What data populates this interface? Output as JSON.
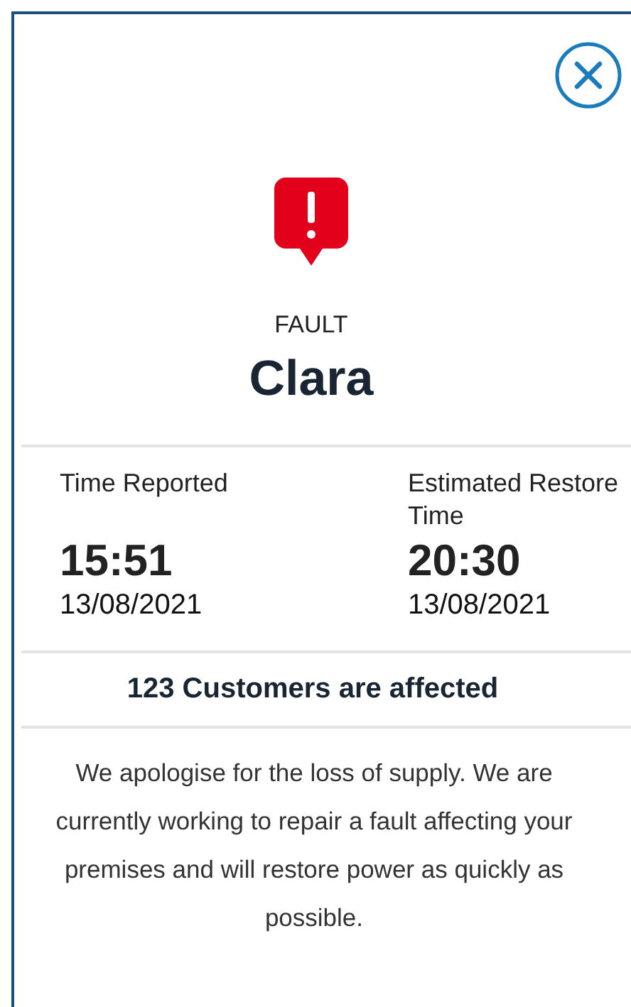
{
  "category": "FAULT",
  "name": "Clara",
  "times": [
    {
      "label": "Time Reported",
      "time": "15:51",
      "date": "13/08/2021"
    },
    {
      "label": "Estimated Restore Time",
      "time": "20:30",
      "date": "13/08/2021"
    }
  ],
  "customers": "123 Customers are affected",
  "message": "We apologise for the loss of supply. We are currently working to repair a fault affecting your premises and will restore power as quickly as possible."
}
